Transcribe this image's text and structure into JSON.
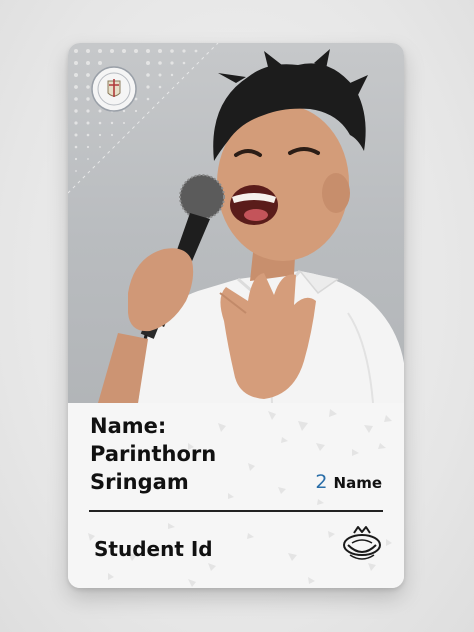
{
  "card": {
    "name_label": "Name:",
    "name_first": "Parinthorn",
    "name_last": "Sringam",
    "count_number": "2",
    "count_label": "Name",
    "student_id_label": "Student Id"
  },
  "icons": {
    "school_logo": "school-crest-icon",
    "emblem": "shell-crown-icon"
  },
  "colors": {
    "card_background": "#f6f6f6",
    "photo_background": "#bcbfc2",
    "accent_number": "#2a6ea8",
    "text": "#111111"
  }
}
